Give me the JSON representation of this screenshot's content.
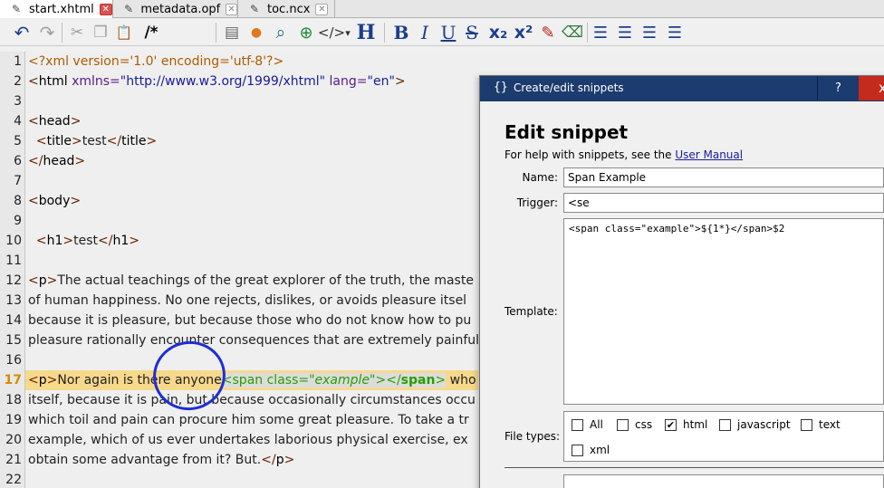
{
  "tabs": [
    {
      "label": "start.xhtml",
      "active": true
    },
    {
      "label": "metadata.opf",
      "active": false
    },
    {
      "label": "toc.ncx",
      "active": false
    }
  ],
  "toolbar": {
    "undo_icon": "↶",
    "redo_icon": "↷",
    "cut_icon": "✂",
    "copy_icon": "❐",
    "paste_icon": "📋",
    "comment_label": "/*",
    "html_icon": "▤",
    "pin_icon": "●",
    "zoom_icon": "⌕",
    "insert_icon": "⊕",
    "tag_icon": "</>",
    "tag_dropdown": "▾",
    "heading_label": "H",
    "bold_label": "B",
    "italic_label": "I",
    "underline_label": "U",
    "strike_label": "S",
    "sub_label": "x₂",
    "sup_label": "x²",
    "brush_icon": "✎",
    "eraser_icon": "⌫",
    "align_left_icon": "☰",
    "align_center_icon": "☰",
    "align_right_icon": "☰",
    "justify_icon": "☰"
  },
  "editor": {
    "current_line": 17,
    "lines": [
      {
        "n": "1"
      },
      {
        "n": "2"
      },
      {
        "n": "3"
      },
      {
        "n": "4"
      },
      {
        "n": "5"
      },
      {
        "n": "6"
      },
      {
        "n": "7"
      },
      {
        "n": "8"
      },
      {
        "n": "9"
      },
      {
        "n": "10"
      },
      {
        "n": "11"
      },
      {
        "n": "12"
      },
      {
        "n": "13"
      },
      {
        "n": "14"
      },
      {
        "n": "15"
      },
      {
        "n": "16"
      },
      {
        "n": "17"
      },
      {
        "n": "18"
      },
      {
        "n": "19"
      },
      {
        "n": "20"
      },
      {
        "n": "21"
      },
      {
        "n": "22"
      }
    ],
    "code": {
      "l1": "<?xml version='1.0' encoding='utf-8'?>",
      "l2_open": "<",
      "l2_tag": "html",
      "l2_attr1": " xmlns=",
      "l2_val1": "\"http://www.w3.org/1999/xhtml\"",
      "l2_attr2": " lang=",
      "l2_val2": "\"en\"",
      "l2_close": ">",
      "l4_open": "<",
      "l4_tag": "head",
      "l4_close": ">",
      "l5_indent": "  ",
      "l5_open": "<",
      "l5_tag": "title",
      "l5_mid": ">",
      "l5_text": "test",
      "l5_end_open": "</",
      "l5_end_tag": "title",
      "l5_end_close": ">",
      "l6_open": "</",
      "l6_tag": "head",
      "l6_close": ">",
      "l8_open": "<",
      "l8_tag": "body",
      "l8_close": ">",
      "l10_indent": "  ",
      "l10_open": "<",
      "l10_tag": "h1",
      "l10_mid": ">",
      "l10_text": "test",
      "l10_end_open": "</",
      "l10_end_tag": "h1",
      "l10_end_close": ">",
      "l12_open": "<",
      "l12_tag": "p",
      "l12_close": ">",
      "l12_text": "The actual teachings of the great explorer of the truth, the maste",
      "l13": "of human happiness. No one rejects, dislikes, or avoids pleasure itsel",
      "l14": "because it is pleasure, but because those who do not know how to pu",
      "l15": "pleasure rationally encounter consequences that are extremely painful",
      "l17_open": "<",
      "l17_tag": "p",
      "l17_close": ">",
      "l17_text": "Nor again is there anyone",
      "l17_span_open": "<span",
      "l17_span_attr": " class=",
      "l17_span_val": "\"example\"",
      "l17_span_mid": "></",
      "l17_span_tag": "span",
      "l17_span_end": ">",
      "l17_tail": " who love",
      "l18": "itself, because it is pain, but because occasionally circumstances occu",
      "l19": "which toil and pain can procure him some great pleasure. To take a tr",
      "l20": "example, which of us ever undertakes laborious physical exercise, ex",
      "l21_text": "obtain some advantage from it? But.",
      "l21_end_open": "</",
      "l21_end_tag": "p",
      "l21_end_close": ">"
    }
  },
  "dialog": {
    "title_icon": "{}",
    "title": "Create/edit snippets",
    "help_label": "?",
    "close_label": "x",
    "heading": "Edit snippet",
    "help_prefix": "For help with snippets, see the ",
    "help_link": "User Manual",
    "name_label": "Name:",
    "name_value": "Span Example",
    "trigger_label": "Trigger:",
    "trigger_value": "<se",
    "template_label": "Template:",
    "template_value": "<span class=\"example\">${1*}</span>$2",
    "filetypes_label": "File types:",
    "filetypes": [
      {
        "label": "All",
        "checked": false
      },
      {
        "label": "css",
        "checked": false
      },
      {
        "label": "html",
        "checked": true
      },
      {
        "label": "javascript",
        "checked": false
      },
      {
        "label": "text",
        "checked": false
      },
      {
        "label": "xml",
        "checked": false
      }
    ],
    "check_mark": "✔"
  }
}
